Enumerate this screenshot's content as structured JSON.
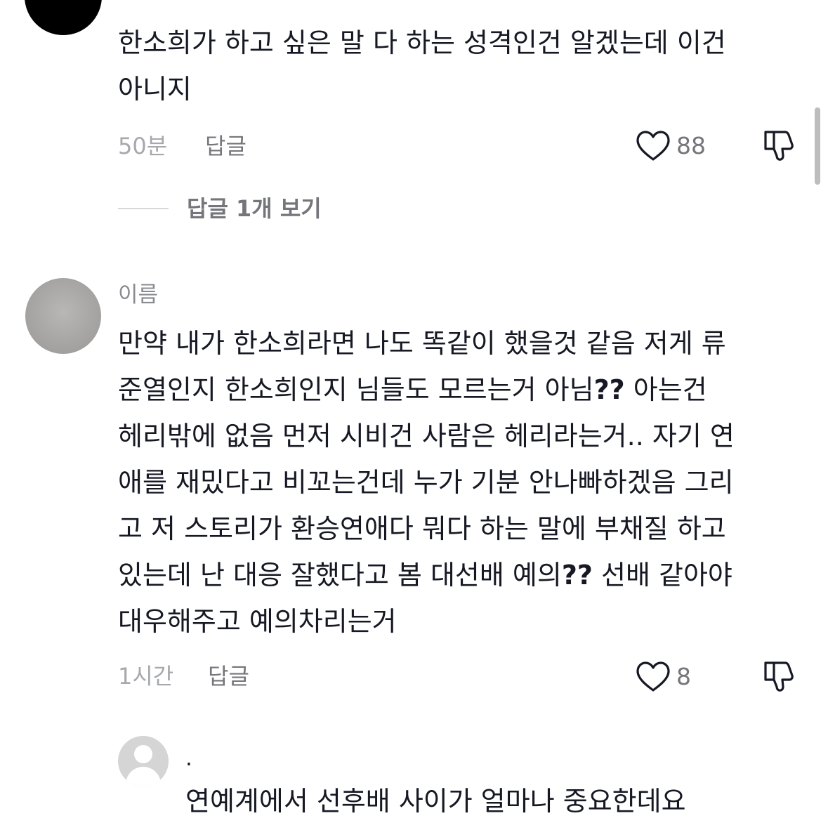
{
  "comments": [
    {
      "text": "한소희가 하고 싶은 말 다 하는 성격인건 알겠는데 이건\n아니지",
      "time": "50분",
      "reply_label": "답글",
      "likes": "88",
      "view_replies": "답글 1개 보기"
    },
    {
      "username": "이름",
      "text_lines": [
        "만약 내가 한소희라면 나도 똑같이 했을것 같음 저게 류",
        "준열인지 한소희인지 님들도 모르는거 아님",
        "??",
        " 아는건",
        "헤리밖에 없음 먼저 시비건 사람은 헤리라는거.. 자기 연",
        "애를 재밌다고 비꼬는건데 누가 기분 안나빠하겠음 그리",
        "고 저 스토리가 환승연애다 뭐다 하는 말에 부채질 하고",
        "있는데 난 대응 잘했다고 봄 대선배 예의",
        "??",
        " 선배 같아야",
        "대우해주고 예의차리는거"
      ],
      "time": "1시간",
      "reply_label": "답글",
      "likes": "8"
    },
    {
      "username": ".",
      "text": "연예계에서 선후배 사이가 얼마나 중요한데요"
    }
  ],
  "icons": {
    "like": "heart-outline-icon",
    "dislike": "thumbs-down-outline-icon"
  },
  "colors": {
    "text": "#161823",
    "muted": "#8a8b91",
    "icon": "#161823"
  }
}
